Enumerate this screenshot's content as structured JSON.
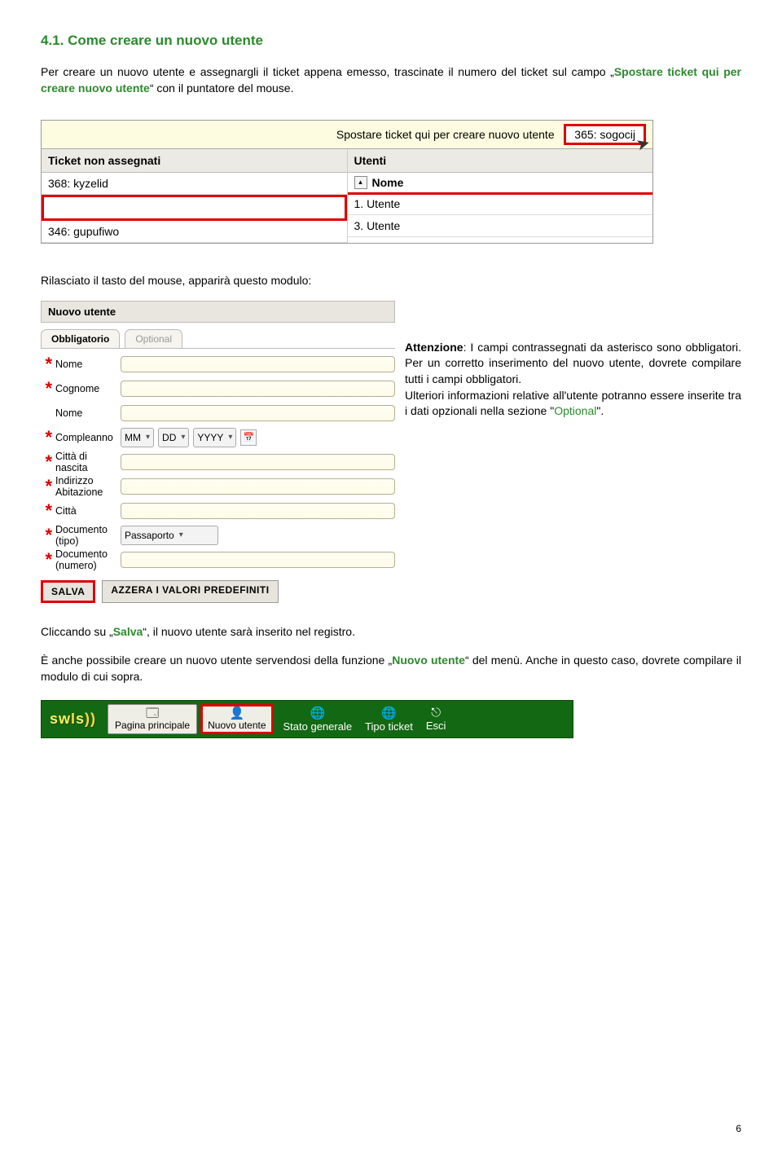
{
  "section": {
    "title": "4.1. Come creare un nuovo utente",
    "intro_a": "Per creare un nuovo utente e assegnargli il ticket appena emesso, trascinate il numero del ticket sul campo „",
    "intro_green": "Spostare ticket qui per creare nuovo utente",
    "intro_b": "“ con il puntatore del mouse.",
    "after_shot": "Rilasciato il tasto del mouse, apparirà questo modulo:",
    "click_a": "Cliccando su „",
    "click_green": "Salva",
    "click_b": "“, il nuovo utente sarà inserito nel registro.",
    "menu_a": "È anche possibile creare un nuovo utente servendosi della funzione „",
    "menu_green": "Nuovo utente",
    "menu_b": "“ del menù. Anche in questo caso, dovrete compilare il modulo di cui sopra."
  },
  "shot1": {
    "topbar_text": "Spostare ticket qui per creare nuovo utente",
    "drag_ticket": "365: sogocij",
    "col1_head": "Ticket non assegnati",
    "col1_r1": "368: kyzelid",
    "col1_r3": "346: gupufiwo",
    "col2_head": "Utenti",
    "col2_nome": "Nome",
    "col2_r1": "1. Utente",
    "col2_r2": "3. Utente"
  },
  "form": {
    "title": "Nuovo utente",
    "tab_req": "Obbligatorio",
    "tab_opt": "Optional",
    "l_nome": "Nome",
    "l_cognome": "Cognome",
    "l_nome2": "Nome",
    "l_comp": "Compleanno",
    "sel_mm": "MM",
    "sel_dd": "DD",
    "sel_yy": "YYYY",
    "l_citta_n": "Città di nascita",
    "l_ind": "Indirizzo Abitazione",
    "l_citta": "Città",
    "l_doc_t": "Documento (tipo)",
    "sel_doc": "Passaporto",
    "l_doc_n": "Documento (numero)",
    "btn_save": "SALVA",
    "btn_reset": "AZZERA I VALORI PREDEFINITI"
  },
  "callout": {
    "warn": "Attenzione",
    "t1": ": I campi contrassegnati da asterisco sono obbligatori. Per un corretto inserimento del nuovo utente, dovrete compilare tutti i campi obbligatori.",
    "t2a": "Ulteriori informazioni relative all'utente potranno essere inserite tra i dati opzionali nella sezione \"",
    "opt": "Optional",
    "t2b": "\"."
  },
  "toolbar": {
    "logo_a": "sw",
    "logo_b": "I",
    "logo_c": "s",
    "b1": "Pagina principale",
    "b2": "Nuovo utente",
    "b3": "Stato generale",
    "b4": "Tipo ticket",
    "b5": "Esci"
  },
  "page": "6"
}
